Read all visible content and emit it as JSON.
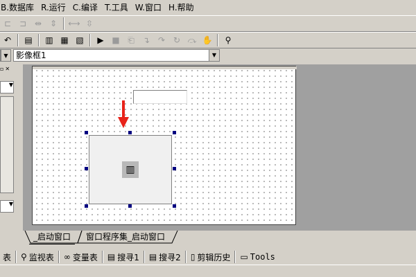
{
  "menu": [
    {
      "key": "B",
      "label": "B.数据库"
    },
    {
      "key": "R",
      "label": "R.运行"
    },
    {
      "key": "C",
      "label": "C.编译"
    },
    {
      "key": "T",
      "label": "T.工具"
    },
    {
      "key": "W",
      "label": "W.窗口"
    },
    {
      "key": "H",
      "label": "H.帮助"
    }
  ],
  "property": {
    "selected_component": "影像框1"
  },
  "tabs": {
    "active": "_启动窗口",
    "inactive": "窗口程序集_启动窗口"
  },
  "bottom": {
    "watch": "监视表",
    "vars": "变量表",
    "search1": "搜寻1",
    "search2": "搜寻2",
    "clip": "剪辑历史",
    "tools": "Tools"
  },
  "icons": {
    "run": "play-icon",
    "stop": "stop-icon"
  },
  "colors": {
    "arrow": "#e8231a",
    "handle": "#000080"
  }
}
